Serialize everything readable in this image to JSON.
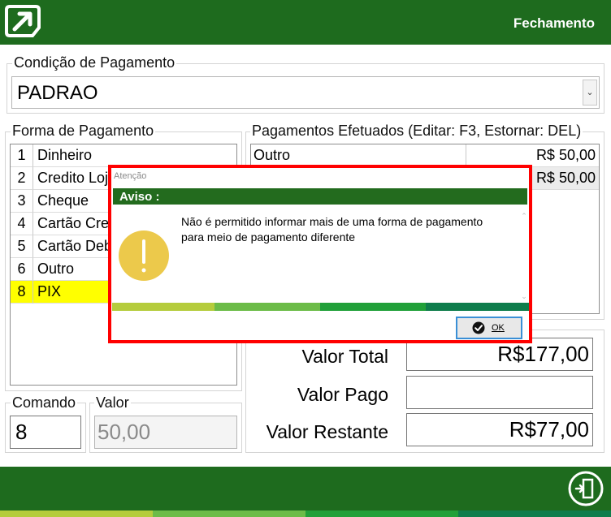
{
  "header": {
    "title": "Fechamento",
    "logo_icon": "arrow-box-logo-icon",
    "color": "#1e6b1e"
  },
  "condicao": {
    "label": "Condição de Pagamento",
    "value": "PADRAO"
  },
  "forma": {
    "label": "Forma de Pagamento",
    "items": [
      {
        "num": "1",
        "name": "Dinheiro"
      },
      {
        "num": "2",
        "name": "Credito Loja"
      },
      {
        "num": "3",
        "name": "Cheque"
      },
      {
        "num": "4",
        "name": "Cartão Credito"
      },
      {
        "num": "5",
        "name": "Cartão Debito"
      },
      {
        "num": "6",
        "name": "Outro"
      },
      {
        "num": "8",
        "name": "PIX",
        "selected": true
      }
    ],
    "selected_color": "#ffff00"
  },
  "efetuados": {
    "label": "Pagamentos Efetuados (Editar: F3, Estornar: DEL)",
    "rows": [
      {
        "name": "Outro",
        "value": "R$ 50,00"
      },
      {
        "name": "",
        "value": "R$ 50,00"
      }
    ]
  },
  "comando": {
    "label": "Comando",
    "value": "8"
  },
  "valor": {
    "label": "Valor",
    "value": "50,00"
  },
  "totals": {
    "total_label": "Valor Total",
    "total_value": "R$177,00",
    "pago_label": "Valor Pago",
    "pago_value": "",
    "restante_label": "Valor Restante",
    "restante_value": "R$77,00"
  },
  "footer": {
    "exit_icon": "exit-door-icon"
  },
  "dialog": {
    "window_title": "Atenção",
    "heading": "Aviso :",
    "message_line1": "Não é permitido informar mais de uma forma de pagamento",
    "message_line2": "para meio de pagamento diferente",
    "icon": "warning-exclamation-icon",
    "icon_color": "#ecc94b",
    "ok_label": "OK",
    "border_color": "#ff0000"
  }
}
